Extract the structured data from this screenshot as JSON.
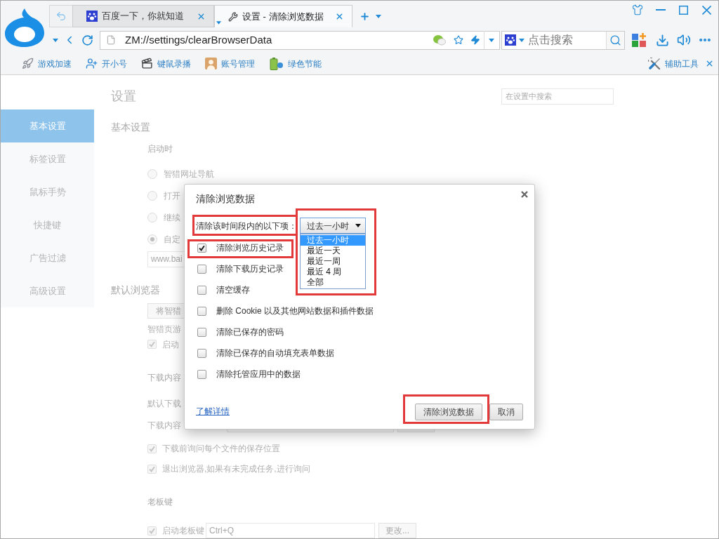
{
  "tabs": [
    {
      "title": "百度一下，你就知道",
      "selected": false
    },
    {
      "title": "设置 - 清除浏览数据",
      "selected": true
    }
  ],
  "address_bar": {
    "url": "ZM://settings/clearBrowserData"
  },
  "search_box": {
    "placeholder": "点击搜索"
  },
  "bookmarks": [
    {
      "label": "游戏加速"
    },
    {
      "label": "开小号"
    },
    {
      "label": "键鼠录播"
    },
    {
      "label": "账号管理"
    },
    {
      "label": "绿色节能"
    }
  ],
  "tools_button": {
    "label": "辅助工具"
  },
  "settings": {
    "title": "设置",
    "search": {
      "placeholder": "在设置中搜索"
    },
    "nav": [
      {
        "label": "基本设置",
        "selected": true
      },
      {
        "label": "标签设置",
        "selected": false
      },
      {
        "label": "鼠标手势",
        "selected": false
      },
      {
        "label": "快捷键",
        "selected": false
      },
      {
        "label": "广告过滤",
        "selected": false
      },
      {
        "label": "高级设置",
        "selected": false
      }
    ],
    "content": [
      {
        "kind": "heading",
        "text": "基本设置"
      },
      {
        "kind": "label",
        "text": "启动时"
      },
      {
        "kind": "radio",
        "label": "智猎网址导航",
        "selected": false
      },
      {
        "kind": "radio",
        "label": "打开",
        "selected": false
      },
      {
        "kind": "radio",
        "label": "继续",
        "selected": false
      },
      {
        "kind": "radio",
        "label": "自定",
        "selected": true
      },
      {
        "kind": "field",
        "value": "www.bai"
      },
      {
        "kind": "heading",
        "text": "默认浏览器"
      },
      {
        "kind": "button",
        "label": "将智猎"
      },
      {
        "kind": "note",
        "text": "智猎页游"
      },
      {
        "kind": "checkbox",
        "label": "启动",
        "checked": true
      },
      {
        "kind": "label",
        "text": "下载内容"
      },
      {
        "kind": "note",
        "text": "默认下载"
      },
      {
        "kind": "path",
        "text": "下载内容"
      },
      {
        "kind": "checkbox",
        "label": "下载前询问每个文件的保存位置",
        "checked": true
      },
      {
        "kind": "checkbox",
        "label": "退出浏览器,如果有未完成任务,进行询问",
        "checked": true
      },
      {
        "kind": "label",
        "text": "老板键"
      },
      {
        "kind": "hotkey",
        "label": "启动老板键",
        "checked": true,
        "value": "Ctrl+Q",
        "button": "更改..."
      }
    ]
  },
  "dialog": {
    "title": "清除浏览数据",
    "time_range": {
      "label": "清除该时间段内的以下项：",
      "label_highlighted": true,
      "value": "过去一小时",
      "expanded": true,
      "highlighted": true,
      "options": [
        {
          "label": "过去一小时",
          "selected": true
        },
        {
          "label": "最近一天",
          "selected": false
        },
        {
          "label": "最近一周",
          "selected": false
        },
        {
          "label": "最近 4 周",
          "selected": false
        },
        {
          "label": "全部",
          "selected": false
        }
      ]
    },
    "items": [
      {
        "label": "清除浏览历史记录",
        "checked": true,
        "highlighted": true
      },
      {
        "label": "清除下载历史记录",
        "checked": false,
        "highlighted": false
      },
      {
        "label": "清空缓存",
        "checked": false,
        "highlighted": false
      },
      {
        "label": "删除 Cookie 以及其他网站数据和插件数据",
        "checked": false,
        "highlighted": false
      },
      {
        "label": "清除已保存的密码",
        "checked": false,
        "highlighted": false
      },
      {
        "label": "清除已保存的自动填充表单数据",
        "checked": false,
        "highlighted": false
      },
      {
        "label": "清除托管应用中的数据",
        "checked": false,
        "highlighted": false
      }
    ],
    "link": "了解详情",
    "buttons": [
      {
        "label": "清除浏览数据",
        "highlighted": true
      },
      {
        "label": "取消",
        "highlighted": false
      }
    ]
  }
}
